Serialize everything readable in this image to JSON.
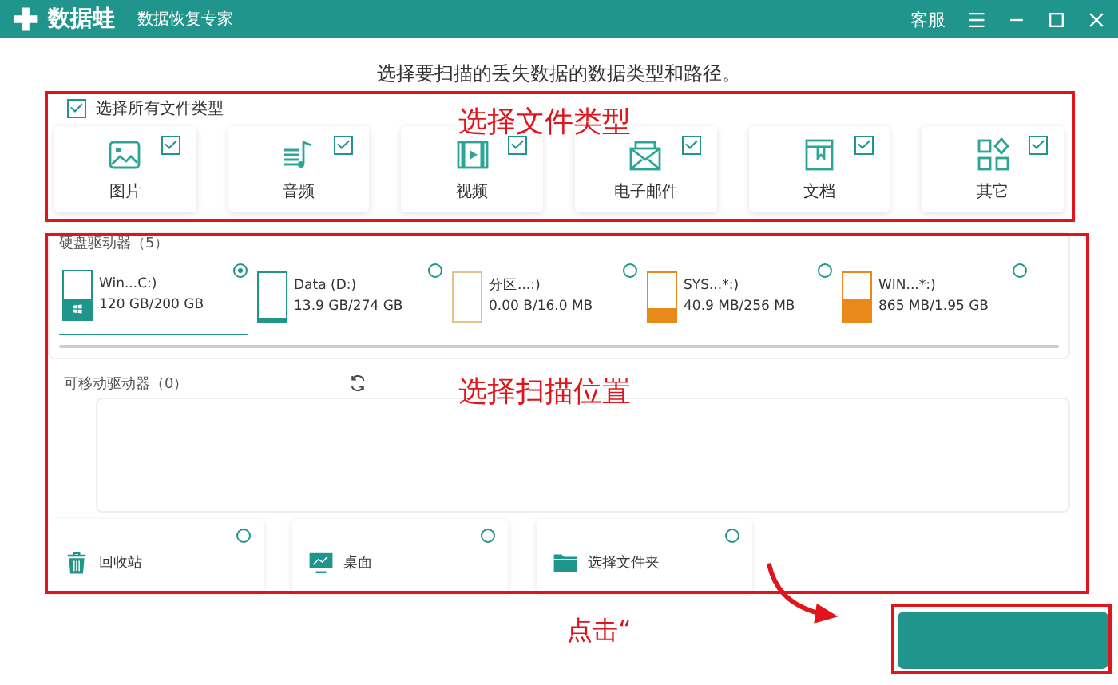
{
  "window": {
    "app_name": "数据蛙",
    "subtitle": "数据恢复专家",
    "service": "客服"
  },
  "instruction": "选择要扫描的丢失数据的数据类型和路径。",
  "file_types": {
    "select_all": {
      "label": "选择所有文件类型",
      "checked": true
    },
    "items": [
      {
        "kind": "image",
        "label": "图片",
        "checked": true
      },
      {
        "kind": "audio",
        "label": "音频",
        "checked": true
      },
      {
        "kind": "video",
        "label": "视频",
        "checked": true
      },
      {
        "kind": "email",
        "label": "电子邮件",
        "checked": true
      },
      {
        "kind": "document",
        "label": "文档",
        "checked": true
      },
      {
        "kind": "other",
        "label": "其它",
        "checked": true
      }
    ]
  },
  "hard_drives": {
    "title": "硬盘驱动器（5）",
    "items": [
      {
        "name": "Win...C:)",
        "usage": "120 GB/200 GB",
        "level": 0.45,
        "color": "#1f958b",
        "system": true,
        "selected": true
      },
      {
        "name": "Data (D:)",
        "usage": "13.9 GB/274 GB",
        "level": 0.06,
        "color": "#1f958b",
        "system": false,
        "selected": false
      },
      {
        "name": "分区...:)",
        "usage": "0.00  B/16.0 MB",
        "level": 0,
        "color": "#e0c48a",
        "system": false,
        "selected": false
      },
      {
        "name": "SYS...*:)",
        "usage": "40.9 MB/256 MB",
        "level": 0.25,
        "color": "#e8891a",
        "system": false,
        "selected": false
      },
      {
        "name": "WIN...*:)",
        "usage": "865 MB/1.95 GB",
        "level": 0.45,
        "color": "#e8891a",
        "system": false,
        "selected": false
      }
    ]
  },
  "removable_drives": {
    "title": "可移动驱动器（0）"
  },
  "locations": [
    {
      "kind": "recycle",
      "label": "回收站",
      "selected": false
    },
    {
      "kind": "desktop",
      "label": "桌面",
      "selected": false
    },
    {
      "kind": "folder",
      "label": "选择文件夹",
      "selected": false
    }
  ],
  "annotations": [
    {
      "kind": "label",
      "text": "选择文件类型"
    },
    {
      "kind": "label",
      "text": "选择扫描位置"
    },
    {
      "kind": "label",
      "text": "点击“"
    }
  ]
}
